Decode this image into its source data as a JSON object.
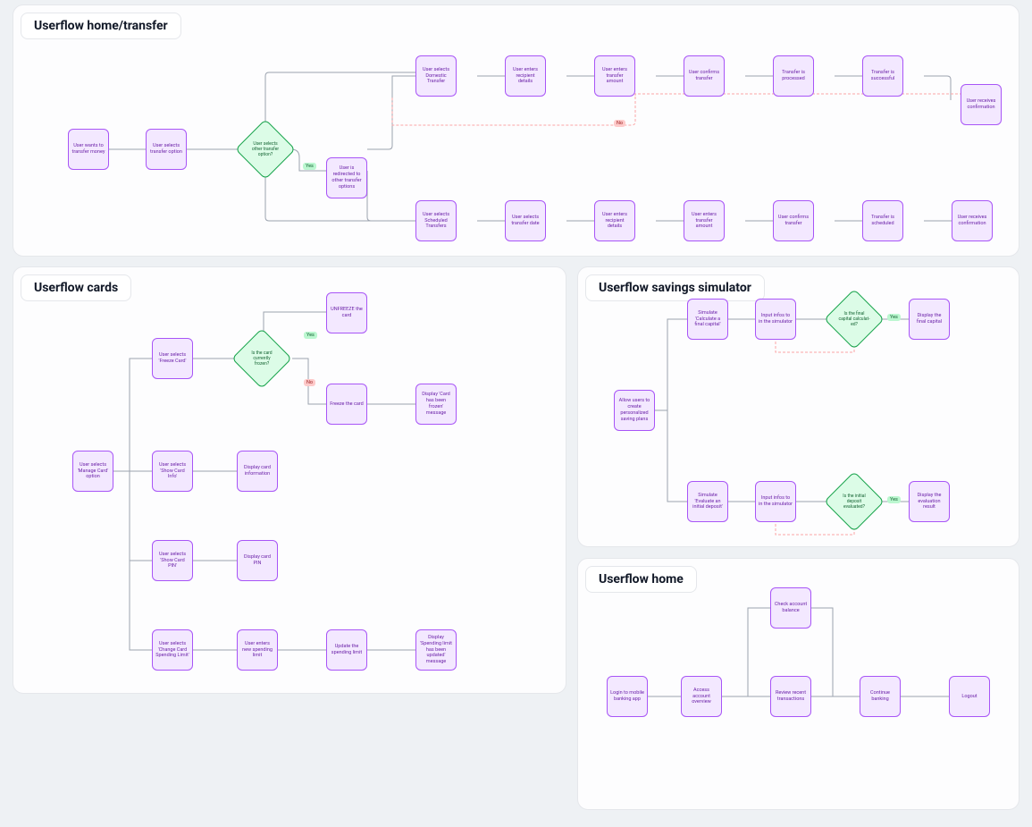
{
  "panels": {
    "transfer": {
      "title": "Userflow home/transfer",
      "nodes": {
        "start": "User wants to transfer money",
        "select_option": "User selects transfer option",
        "decision": "User selects other transfer option?",
        "redirect": "User is redirected to other transfer options",
        "dom": "User selects Domestic Transfer",
        "dom_recip": "User enters recipient details",
        "dom_amount": "User enters transfer amount",
        "dom_confirm": "User confirms transfer",
        "dom_proc": "Transfer is processed",
        "dom_succ": "Transfer is successful",
        "dom_conf": "User receives confirmation",
        "sch": "User selects Scheduled Transfers",
        "sch_date": "User selects transfer date",
        "sch_recip": "User enters recipient details",
        "sch_amount": "User enters transfer amount",
        "sch_confirm": "User confirms transfer",
        "sch_sched": "Transfer is scheduled",
        "sch_conf": "User receives confirmation"
      },
      "badges": {
        "yes": "Yes",
        "no": "No"
      }
    },
    "cards": {
      "title": "Userflow cards",
      "nodes": {
        "manage": "User selects 'Manage Card' option",
        "freeze_sel": "User selects 'Freeze Card'",
        "freeze_dec": "Is the card currently frozen?",
        "unfreeze": "UNFREEZE the card",
        "freeze": "Freeze the card",
        "frozen_msg": "Display 'Card has been frozen' message",
        "info_sel": "User selects 'Show Card Info'",
        "info_disp": "Display card information",
        "pin_sel": "User selects 'Show Card PIN'",
        "pin_disp": "Display card PIN",
        "limit_sel": "User selects 'Change Card Spending Limit'",
        "limit_enter": "User enters new spending limit",
        "limit_update": "Update the spending limit",
        "limit_msg": "Display 'Spending limit has been updated' message"
      },
      "badges": {
        "yes": "Yes",
        "no": "No"
      }
    },
    "savings": {
      "title": "Userflow savings simulator",
      "nodes": {
        "start": "Allow users to create personalized saving plans",
        "calc": "Simulate 'Calculate a final capital'",
        "calc_input": "Input infos to in the simulator",
        "calc_dec": "Is the final capital calculat- ed?",
        "calc_out": "Display the final capital",
        "eval": "Simulate 'Evaluate an initial deposit'",
        "eval_input": "Input infos to in the simulator",
        "eval_dec": "Is the initial deposit evaluated?",
        "eval_out": "Display the evaluation result"
      },
      "badges": {
        "yes": "Yes"
      }
    },
    "home": {
      "title": "Userflow home",
      "nodes": {
        "login": "Login to mobile banking app",
        "overview": "Access account overview",
        "balance": "Check account balance",
        "recent": "Review recent transactions",
        "continue": "Continue banking",
        "logout": "Logout"
      }
    }
  },
  "colors": {
    "node_border": "#a855f7",
    "node_fill": "#f3e8ff",
    "decision_border": "#16a34a",
    "decision_fill": "#dcfce7"
  }
}
